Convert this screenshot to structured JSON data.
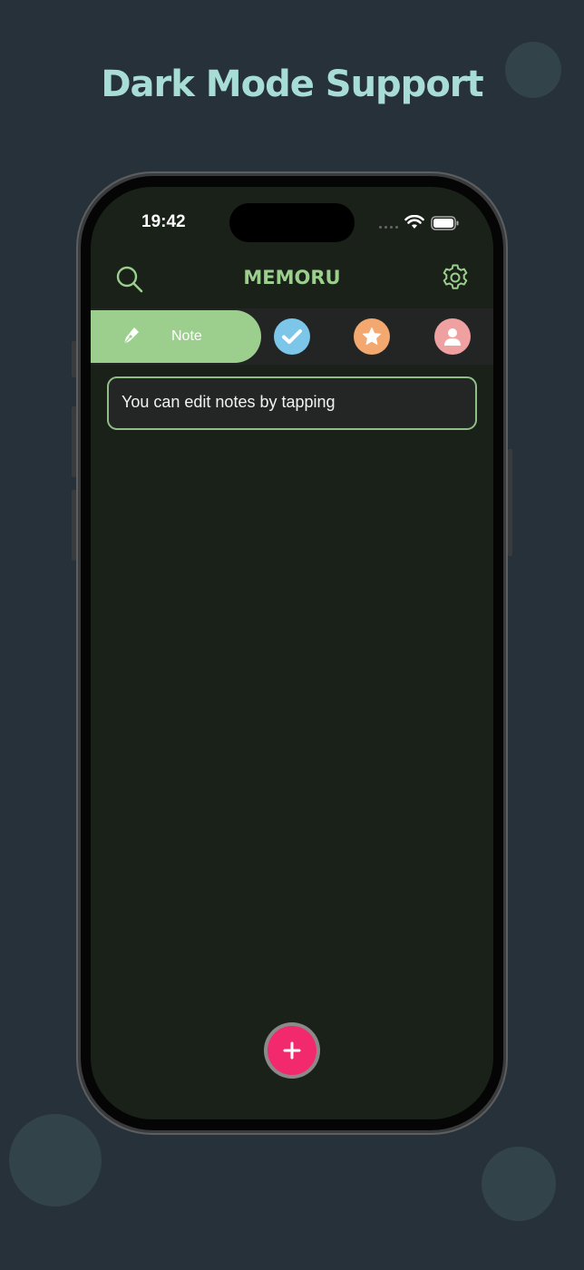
{
  "headline": "Dark Mode Support",
  "status_bar": {
    "time": "19:42"
  },
  "app": {
    "title": "MEMORU",
    "tabs": [
      {
        "label": "Note",
        "icon": "pen-icon",
        "color": "#9ccf8e",
        "selected": true
      },
      {
        "label": "",
        "icon": "check-icon",
        "color": "#7cc6ea",
        "selected": false
      },
      {
        "label": "",
        "icon": "star-icon",
        "color": "#f2a86f",
        "selected": false
      },
      {
        "label": "",
        "icon": "user-icon",
        "color": "#efa0a0",
        "selected": false
      }
    ],
    "notes": [
      {
        "text": "You can edit notes by tapping"
      }
    ],
    "fab_icon": "plus-icon"
  },
  "colors": {
    "background": "#27313a",
    "headline": "#a8ddd6",
    "accent": "#9ccf8e",
    "screen": "#1a2119",
    "fab": "#f2296c"
  }
}
